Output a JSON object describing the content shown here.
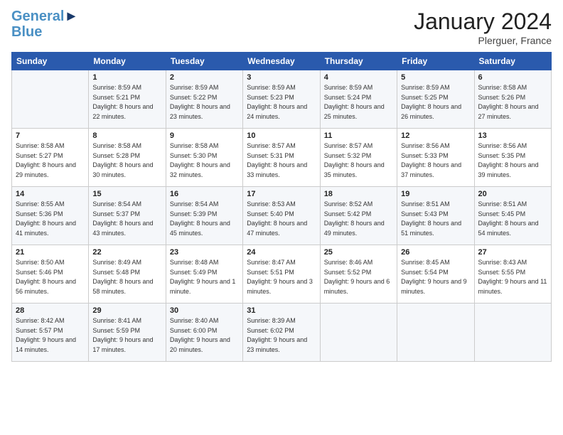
{
  "logo": {
    "line1": "General",
    "line2": "Blue"
  },
  "title": "January 2024",
  "location": "Plerguer, France",
  "weekdays": [
    "Sunday",
    "Monday",
    "Tuesday",
    "Wednesday",
    "Thursday",
    "Friday",
    "Saturday"
  ],
  "weeks": [
    [
      {
        "num": "",
        "sunrise": "",
        "sunset": "",
        "daylight": ""
      },
      {
        "num": "1",
        "sunrise": "Sunrise: 8:59 AM",
        "sunset": "Sunset: 5:21 PM",
        "daylight": "Daylight: 8 hours and 22 minutes."
      },
      {
        "num": "2",
        "sunrise": "Sunrise: 8:59 AM",
        "sunset": "Sunset: 5:22 PM",
        "daylight": "Daylight: 8 hours and 23 minutes."
      },
      {
        "num": "3",
        "sunrise": "Sunrise: 8:59 AM",
        "sunset": "Sunset: 5:23 PM",
        "daylight": "Daylight: 8 hours and 24 minutes."
      },
      {
        "num": "4",
        "sunrise": "Sunrise: 8:59 AM",
        "sunset": "Sunset: 5:24 PM",
        "daylight": "Daylight: 8 hours and 25 minutes."
      },
      {
        "num": "5",
        "sunrise": "Sunrise: 8:59 AM",
        "sunset": "Sunset: 5:25 PM",
        "daylight": "Daylight: 8 hours and 26 minutes."
      },
      {
        "num": "6",
        "sunrise": "Sunrise: 8:58 AM",
        "sunset": "Sunset: 5:26 PM",
        "daylight": "Daylight: 8 hours and 27 minutes."
      }
    ],
    [
      {
        "num": "7",
        "sunrise": "Sunrise: 8:58 AM",
        "sunset": "Sunset: 5:27 PM",
        "daylight": "Daylight: 8 hours and 29 minutes."
      },
      {
        "num": "8",
        "sunrise": "Sunrise: 8:58 AM",
        "sunset": "Sunset: 5:28 PM",
        "daylight": "Daylight: 8 hours and 30 minutes."
      },
      {
        "num": "9",
        "sunrise": "Sunrise: 8:58 AM",
        "sunset": "Sunset: 5:30 PM",
        "daylight": "Daylight: 8 hours and 32 minutes."
      },
      {
        "num": "10",
        "sunrise": "Sunrise: 8:57 AM",
        "sunset": "Sunset: 5:31 PM",
        "daylight": "Daylight: 8 hours and 33 minutes."
      },
      {
        "num": "11",
        "sunrise": "Sunrise: 8:57 AM",
        "sunset": "Sunset: 5:32 PM",
        "daylight": "Daylight: 8 hours and 35 minutes."
      },
      {
        "num": "12",
        "sunrise": "Sunrise: 8:56 AM",
        "sunset": "Sunset: 5:33 PM",
        "daylight": "Daylight: 8 hours and 37 minutes."
      },
      {
        "num": "13",
        "sunrise": "Sunrise: 8:56 AM",
        "sunset": "Sunset: 5:35 PM",
        "daylight": "Daylight: 8 hours and 39 minutes."
      }
    ],
    [
      {
        "num": "14",
        "sunrise": "Sunrise: 8:55 AM",
        "sunset": "Sunset: 5:36 PM",
        "daylight": "Daylight: 8 hours and 41 minutes."
      },
      {
        "num": "15",
        "sunrise": "Sunrise: 8:54 AM",
        "sunset": "Sunset: 5:37 PM",
        "daylight": "Daylight: 8 hours and 43 minutes."
      },
      {
        "num": "16",
        "sunrise": "Sunrise: 8:54 AM",
        "sunset": "Sunset: 5:39 PM",
        "daylight": "Daylight: 8 hours and 45 minutes."
      },
      {
        "num": "17",
        "sunrise": "Sunrise: 8:53 AM",
        "sunset": "Sunset: 5:40 PM",
        "daylight": "Daylight: 8 hours and 47 minutes."
      },
      {
        "num": "18",
        "sunrise": "Sunrise: 8:52 AM",
        "sunset": "Sunset: 5:42 PM",
        "daylight": "Daylight: 8 hours and 49 minutes."
      },
      {
        "num": "19",
        "sunrise": "Sunrise: 8:51 AM",
        "sunset": "Sunset: 5:43 PM",
        "daylight": "Daylight: 8 hours and 51 minutes."
      },
      {
        "num": "20",
        "sunrise": "Sunrise: 8:51 AM",
        "sunset": "Sunset: 5:45 PM",
        "daylight": "Daylight: 8 hours and 54 minutes."
      }
    ],
    [
      {
        "num": "21",
        "sunrise": "Sunrise: 8:50 AM",
        "sunset": "Sunset: 5:46 PM",
        "daylight": "Daylight: 8 hours and 56 minutes."
      },
      {
        "num": "22",
        "sunrise": "Sunrise: 8:49 AM",
        "sunset": "Sunset: 5:48 PM",
        "daylight": "Daylight: 8 hours and 58 minutes."
      },
      {
        "num": "23",
        "sunrise": "Sunrise: 8:48 AM",
        "sunset": "Sunset: 5:49 PM",
        "daylight": "Daylight: 9 hours and 1 minute."
      },
      {
        "num": "24",
        "sunrise": "Sunrise: 8:47 AM",
        "sunset": "Sunset: 5:51 PM",
        "daylight": "Daylight: 9 hours and 3 minutes."
      },
      {
        "num": "25",
        "sunrise": "Sunrise: 8:46 AM",
        "sunset": "Sunset: 5:52 PM",
        "daylight": "Daylight: 9 hours and 6 minutes."
      },
      {
        "num": "26",
        "sunrise": "Sunrise: 8:45 AM",
        "sunset": "Sunset: 5:54 PM",
        "daylight": "Daylight: 9 hours and 9 minutes."
      },
      {
        "num": "27",
        "sunrise": "Sunrise: 8:43 AM",
        "sunset": "Sunset: 5:55 PM",
        "daylight": "Daylight: 9 hours and 11 minutes."
      }
    ],
    [
      {
        "num": "28",
        "sunrise": "Sunrise: 8:42 AM",
        "sunset": "Sunset: 5:57 PM",
        "daylight": "Daylight: 9 hours and 14 minutes."
      },
      {
        "num": "29",
        "sunrise": "Sunrise: 8:41 AM",
        "sunset": "Sunset: 5:59 PM",
        "daylight": "Daylight: 9 hours and 17 minutes."
      },
      {
        "num": "30",
        "sunrise": "Sunrise: 8:40 AM",
        "sunset": "Sunset: 6:00 PM",
        "daylight": "Daylight: 9 hours and 20 minutes."
      },
      {
        "num": "31",
        "sunrise": "Sunrise: 8:39 AM",
        "sunset": "Sunset: 6:02 PM",
        "daylight": "Daylight: 9 hours and 23 minutes."
      },
      {
        "num": "",
        "sunrise": "",
        "sunset": "",
        "daylight": ""
      },
      {
        "num": "",
        "sunrise": "",
        "sunset": "",
        "daylight": ""
      },
      {
        "num": "",
        "sunrise": "",
        "sunset": "",
        "daylight": ""
      }
    ]
  ]
}
